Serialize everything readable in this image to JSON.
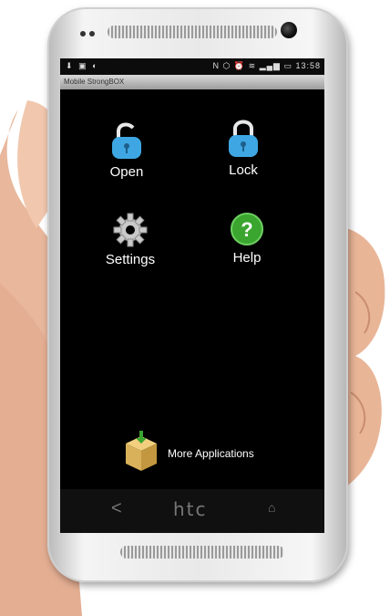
{
  "status_bar": {
    "time": "13:58"
  },
  "app": {
    "title": "Mobile StrongBOX"
  },
  "menu": {
    "items": [
      {
        "label": "Open",
        "icon": "unlocked-padlock-icon"
      },
      {
        "label": "Lock",
        "icon": "locked-padlock-icon"
      },
      {
        "label": "Settings",
        "icon": "gear-icon"
      },
      {
        "label": "Help",
        "icon": "help-icon"
      }
    ]
  },
  "more_apps": {
    "label": "More Applications",
    "icon": "package-box-icon"
  },
  "device": {
    "brand": "htc",
    "nav_back": "<"
  },
  "colors": {
    "screen_bg": "#000000",
    "lock_blue": "#3ea7e3",
    "help_green": "#3aa52f",
    "box_tan": "#d9b15a"
  }
}
